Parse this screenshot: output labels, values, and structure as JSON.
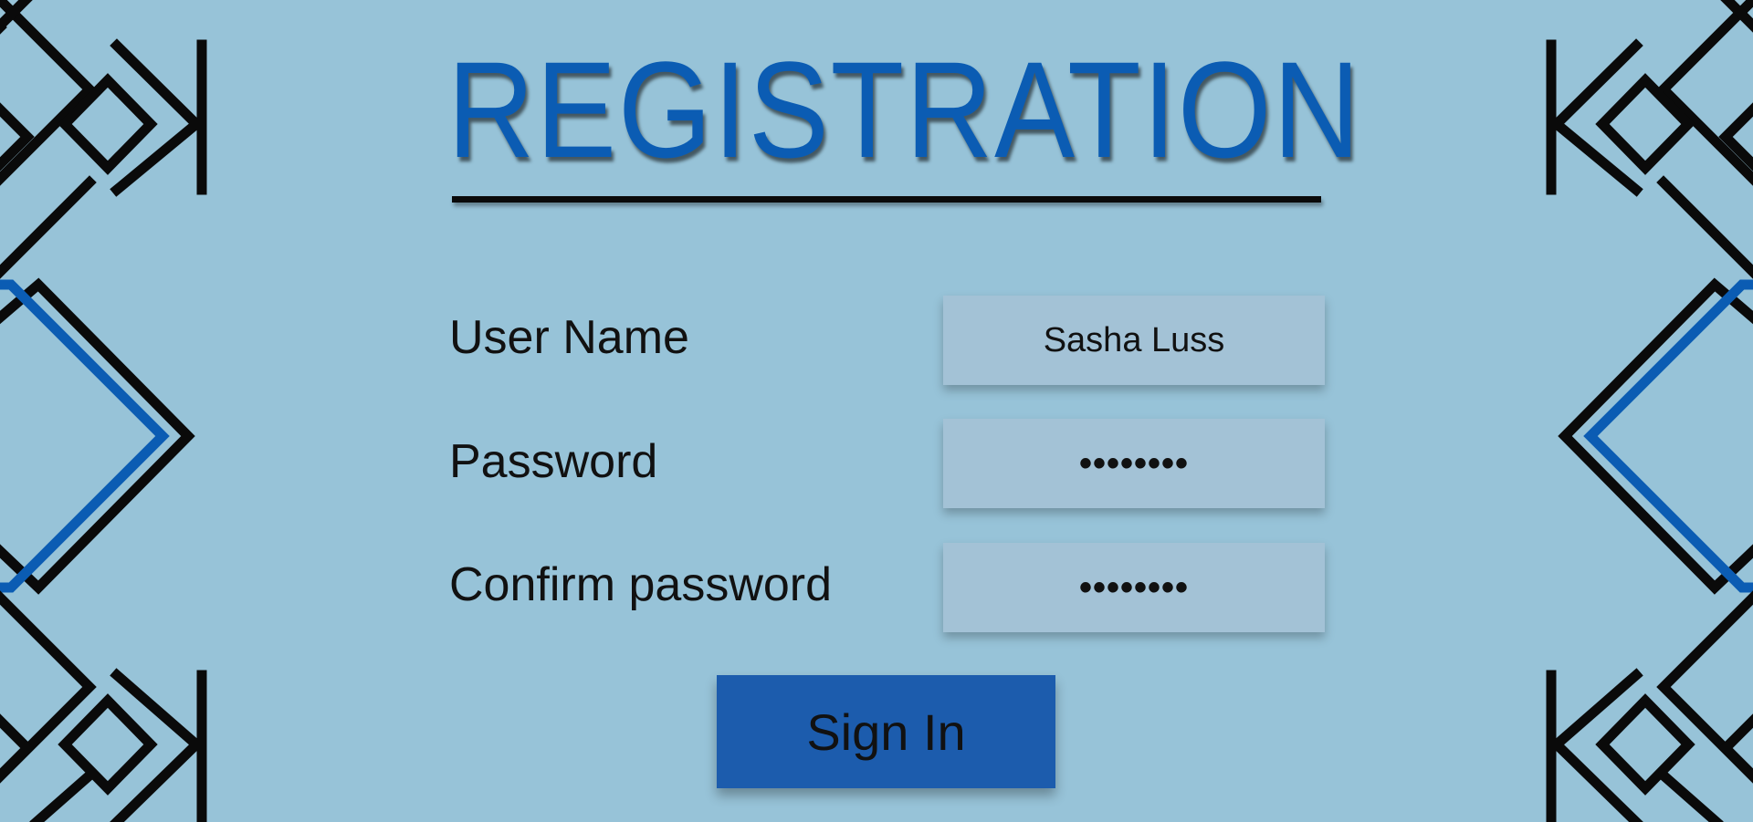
{
  "form": {
    "title": "REGISTRATION",
    "username_label": "User Name",
    "username_value": "Sasha Luss",
    "password_label": "Password",
    "password_value": "••••••••",
    "confirm_label": "Confirm password",
    "confirm_value": "••••••••",
    "submit_label": "Sign In"
  },
  "colors": {
    "background": "#97c3d8",
    "accent_blue": "#0b5cb3",
    "button_blue": "#1c5cad",
    "field_background": "#a3c2d6",
    "ornament_black": "#0a0a0a"
  },
  "decorations": {
    "left": "geometric-diamond-ornament",
    "right": "geometric-diamond-ornament"
  }
}
